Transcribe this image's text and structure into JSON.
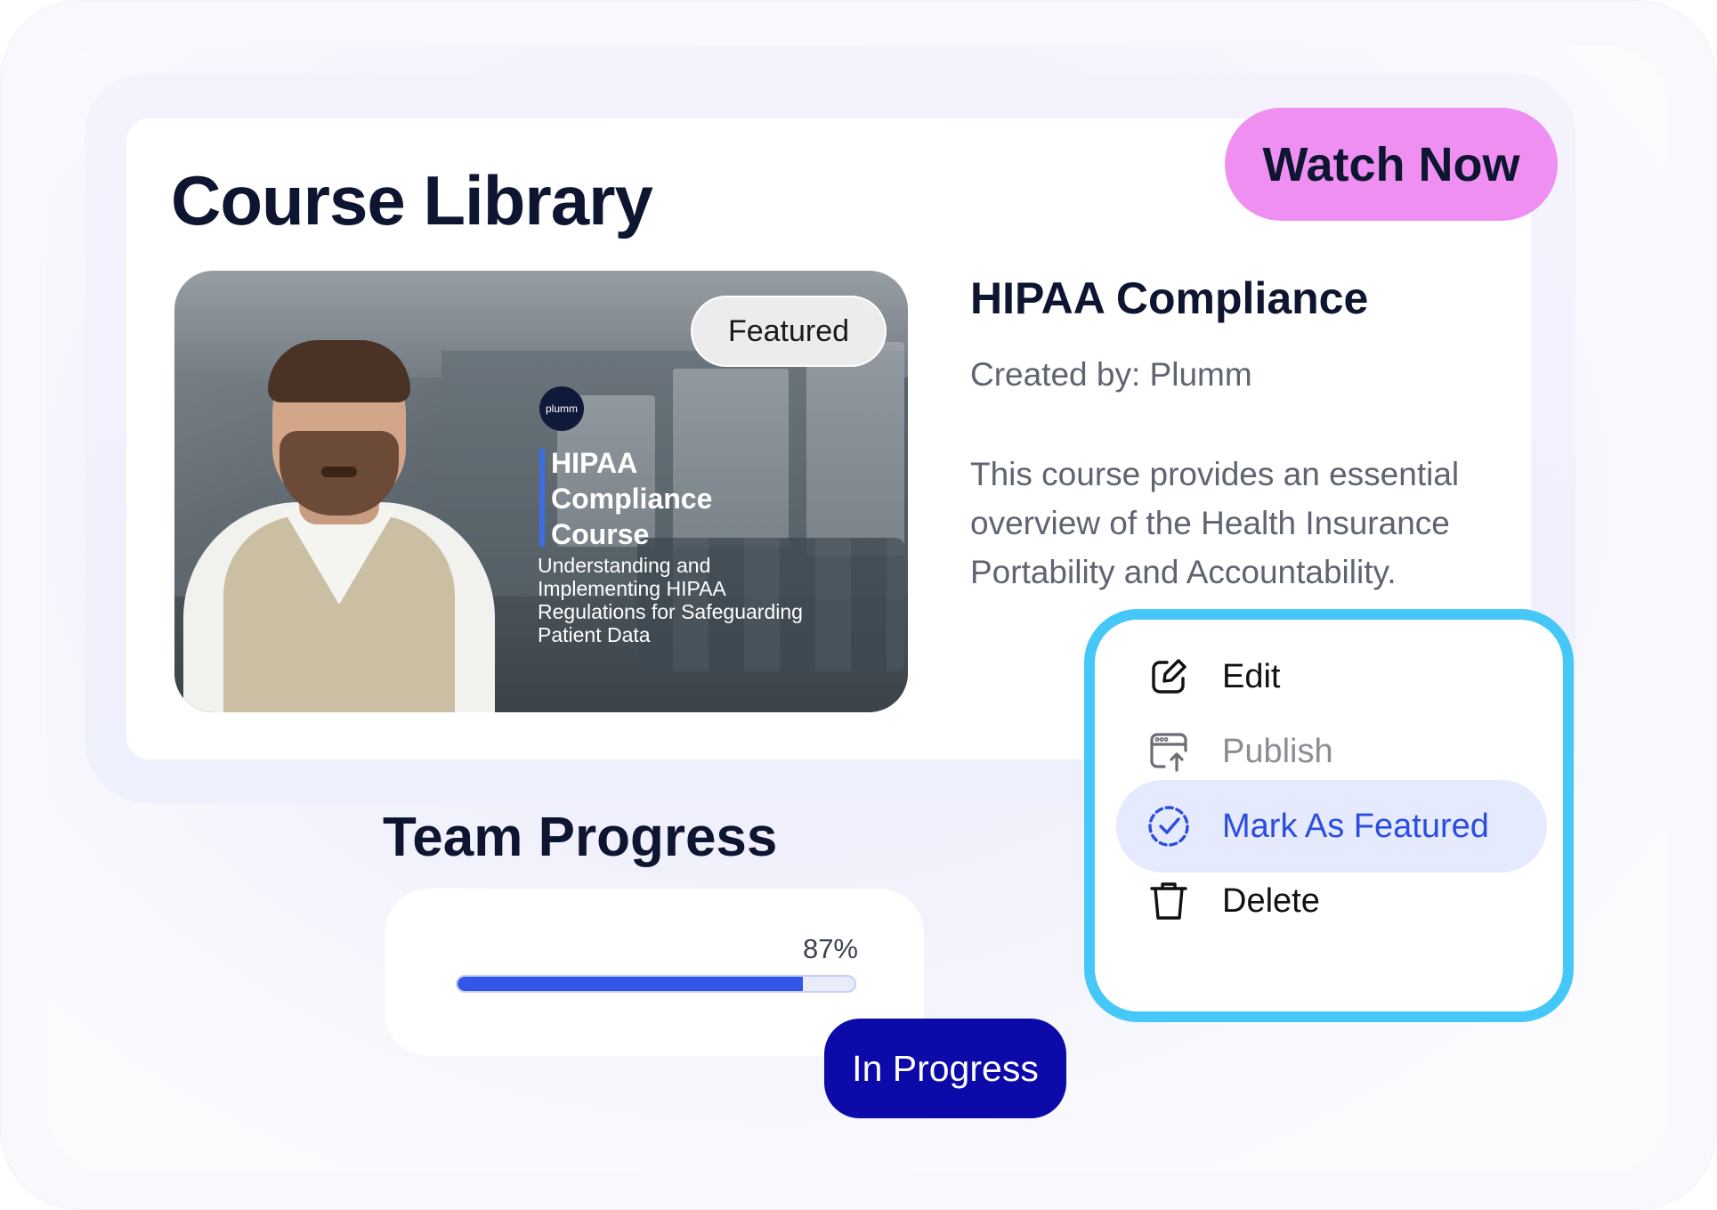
{
  "library": {
    "title": "Course Library",
    "watch_button": "Watch Now"
  },
  "thumbnail": {
    "featured_badge": "Featured",
    "logo_text": "plumm",
    "title": "HIPAA\nCompliance\nCourse",
    "subtitle": "Understanding and\nImplementing HIPAA\nRegulations for Safeguarding\nPatient Data"
  },
  "course": {
    "title": "HIPAA Compliance",
    "created_by": "Created by: Plumm",
    "description": "This course provides an essential overview of the Health Insurance Portability and Accountability."
  },
  "team_progress": {
    "title": "Team Progress",
    "percent_label": "87%",
    "percent_value": 87,
    "status": "In Progress"
  },
  "context_menu": {
    "items": [
      {
        "label": "Edit",
        "icon": "edit-icon",
        "state": "normal"
      },
      {
        "label": "Publish",
        "icon": "publish-icon",
        "state": "disabled"
      },
      {
        "label": "Mark As Featured",
        "icon": "check-circle-icon",
        "state": "active"
      },
      {
        "label": "Delete",
        "icon": "trash-icon",
        "state": "normal"
      }
    ]
  },
  "colors": {
    "watch_button": "#ef8ff2",
    "menu_border": "#45c8f8",
    "progress_fill": "#3057e8",
    "status_badge": "#0c0aa8",
    "active_item": "#2b4de0"
  }
}
